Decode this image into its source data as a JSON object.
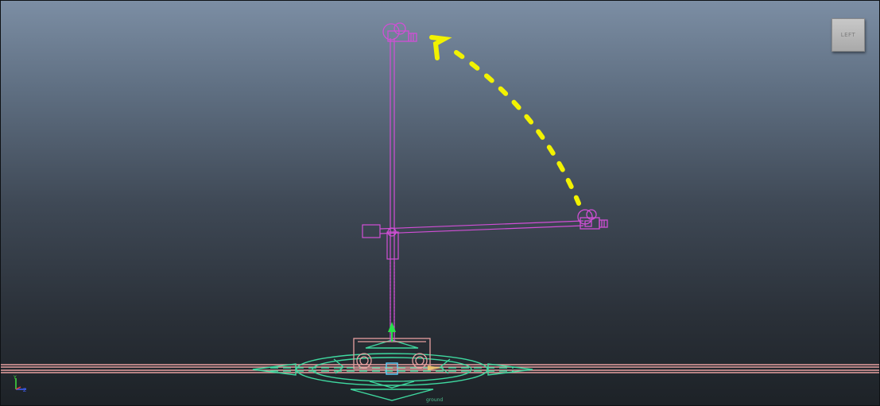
{
  "viewport": {
    "name": "left-orthographic-viewport"
  },
  "view_cube": {
    "label": "LEFT"
  },
  "ground_control": {
    "label": "ground"
  },
  "colors": {
    "rig": "#d14fd6",
    "motion_path": "#f2f200",
    "ground_controls": "#3fd9a0",
    "ground_rails": "#e8a0a0",
    "axis_x": "#e04040",
    "axis_y": "#40e040",
    "axis_z": "#4060ff",
    "move_arrow": "#2be04b"
  },
  "icons": {
    "axis_gizmo": "axis-indicator-icon",
    "move_manipulator": "move-arrow-icon"
  }
}
